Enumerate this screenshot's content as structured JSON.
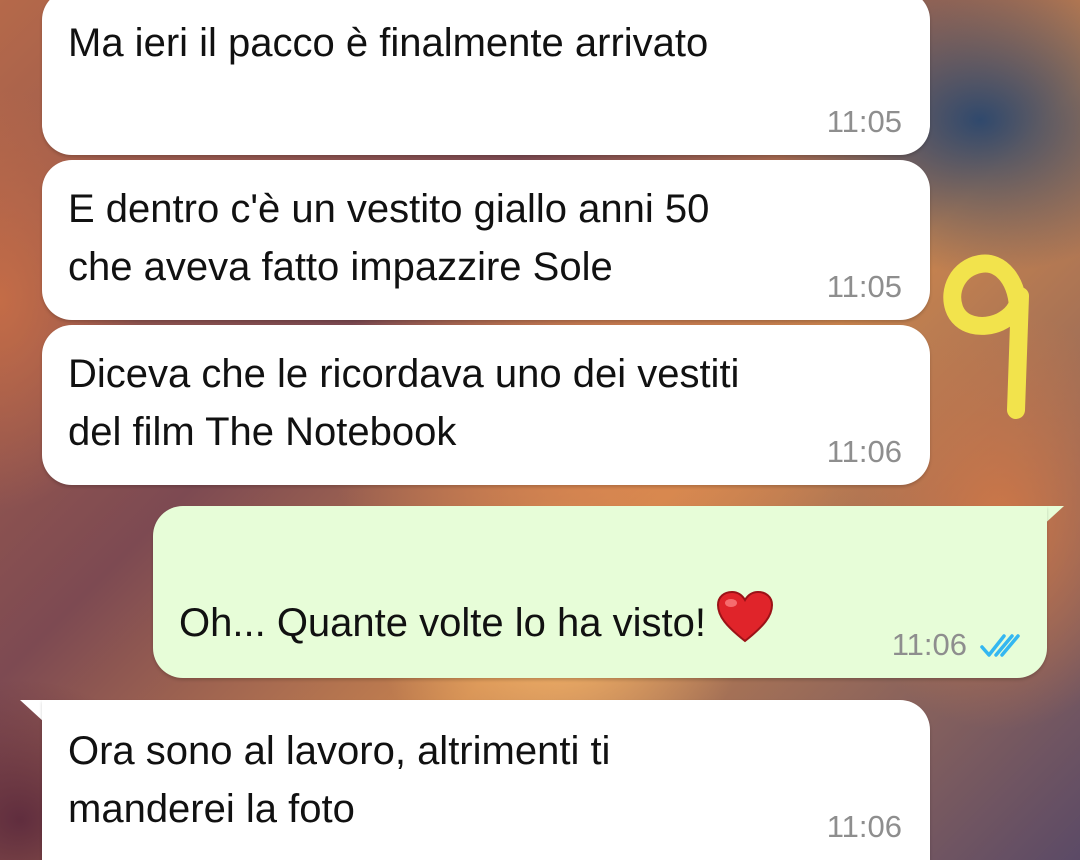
{
  "chat": {
    "messages": [
      {
        "text": "Ma ieri il pacco è finalmente arrivato",
        "time": "11:05",
        "direction": "incoming"
      },
      {
        "text": "E dentro c'è un vestito giallo anni 50\nche aveva fatto impazzire Sole",
        "time": "11:05",
        "direction": "incoming"
      },
      {
        "text": "Diceva che le ricordava uno dei vestiti\ndel film The Notebook",
        "time": "11:06",
        "direction": "incoming"
      },
      {
        "text": "Oh... Quante volte lo ha visto!",
        "time": "11:06",
        "direction": "outgoing",
        "emoji": "heart-emoji",
        "status": "read"
      },
      {
        "text": "Ora sono al lavoro, altrimenti ti\nmanderei la foto",
        "time": "11:06",
        "direction": "incoming"
      }
    ]
  },
  "annotation": {
    "text": "9",
    "color": "#f2e34c"
  },
  "colors": {
    "incoming_bubble": "#ffffff",
    "outgoing_bubble": "#e7fdd8",
    "timestamp": "#8e8e8e",
    "read_ticks": "#34b7f1"
  },
  "icons": {
    "read_receipt": "double-check-icon",
    "emoji": "red-heart-icon"
  }
}
